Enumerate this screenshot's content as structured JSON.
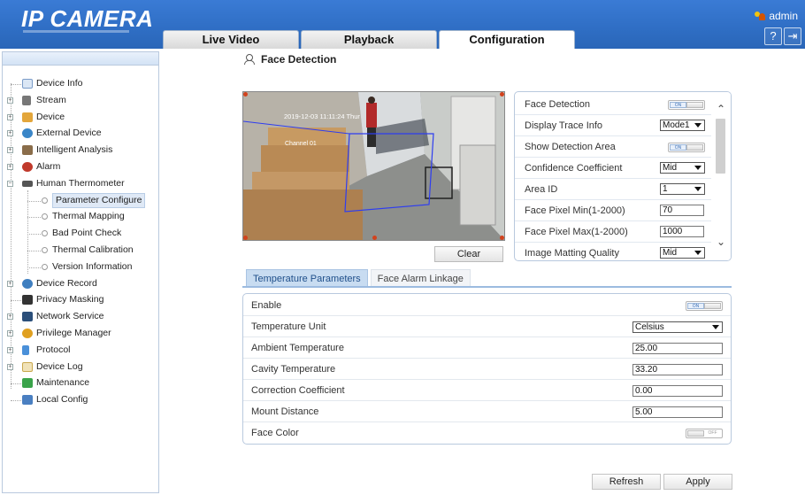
{
  "header": {
    "logo": "IP CAMERA",
    "user": "admin",
    "tabs": [
      {
        "label": "Live Video"
      },
      {
        "label": "Playback"
      },
      {
        "label": "Configuration"
      }
    ]
  },
  "sidebar": {
    "items": [
      {
        "label": "Device Info"
      },
      {
        "label": "Stream"
      },
      {
        "label": "Device"
      },
      {
        "label": "External Device"
      },
      {
        "label": "Intelligent Analysis"
      },
      {
        "label": "Alarm"
      },
      {
        "label": "Human Thermometer"
      },
      {
        "label": "Parameter Configure"
      },
      {
        "label": "Thermal Mapping"
      },
      {
        "label": "Bad Point Check"
      },
      {
        "label": "Thermal Calibration"
      },
      {
        "label": "Version Information"
      },
      {
        "label": "Device Record"
      },
      {
        "label": "Privacy Masking"
      },
      {
        "label": "Network Service"
      },
      {
        "label": "Privilege Manager"
      },
      {
        "label": "Protocol"
      },
      {
        "label": "Device Log"
      },
      {
        "label": "Maintenance"
      },
      {
        "label": "Local Config"
      }
    ]
  },
  "page": {
    "title": "Face Detection"
  },
  "video": {
    "osd_time": "2019-12-03 11:11:24 Thur",
    "osd_channel": "Channel 01",
    "clear_label": "Clear"
  },
  "face_detection": {
    "rows": [
      {
        "label": "Face Detection",
        "toggle": "ON"
      },
      {
        "label": "Display Trace Info",
        "value": "Mode1"
      },
      {
        "label": "Show Detection Area",
        "toggle": "ON"
      },
      {
        "label": "Confidence Coefficient",
        "value": "Mid"
      },
      {
        "label": "Area ID",
        "value": "1"
      },
      {
        "label": "Face Pixel Min(1-2000)",
        "value": "70"
      },
      {
        "label": "Face Pixel Max(1-2000)",
        "value": "1000"
      },
      {
        "label": "Image Matting Quality",
        "value": "Mid"
      }
    ]
  },
  "subtabs": [
    {
      "label": "Temperature Parameters"
    },
    {
      "label": "Face Alarm Linkage"
    }
  ],
  "temperature": {
    "rows": [
      {
        "label": "Enable",
        "toggle": "ON"
      },
      {
        "label": "Temperature Unit",
        "value": "Celsius"
      },
      {
        "label": "Ambient Temperature",
        "value": "25.00"
      },
      {
        "label": "Cavity Temperature",
        "value": "33.20"
      },
      {
        "label": "Correction Coefficient",
        "value": "0.00"
      },
      {
        "label": "Mount Distance",
        "value": "5.00"
      },
      {
        "label": "Face Color",
        "toggle": "OFF"
      }
    ]
  },
  "footer": {
    "refresh_label": "Refresh",
    "apply_label": "Apply"
  },
  "colors": {
    "header_blue": "#2f6ec4",
    "accent_blue": "#9cbbe0",
    "detection_area": "#2e3df0",
    "corner_marker": "#d2421d"
  }
}
